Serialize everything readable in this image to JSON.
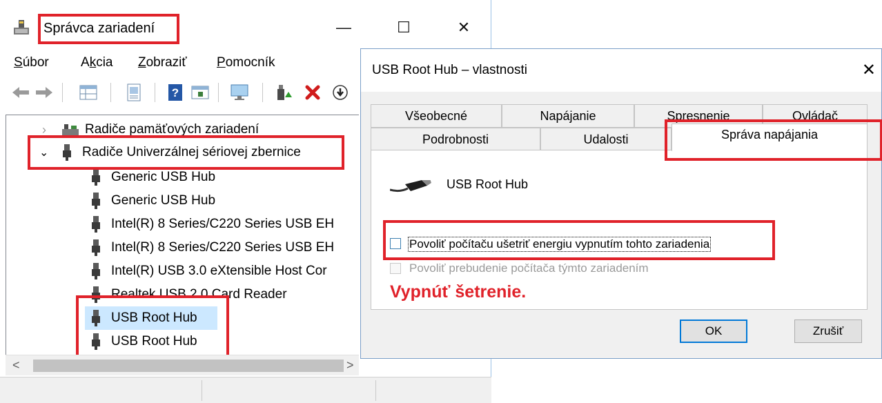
{
  "device_manager": {
    "title": "Správca zariadení",
    "controls": {
      "minimize": "—",
      "maximize": "☐",
      "close": "✕"
    },
    "menu": [
      {
        "pre": "",
        "u": "S",
        "post": "úbor"
      },
      {
        "pre": "A",
        "u": "k",
        "post": "cia"
      },
      {
        "pre": "",
        "u": "Z",
        "post": "obraziť"
      },
      {
        "pre": "",
        "u": "P",
        "post": "omocník"
      }
    ],
    "toolbar_icons": [
      "back-arrow-icon",
      "forward-arrow-icon",
      "properties-grid-icon",
      "document-icon",
      "help-icon",
      "view-icon",
      "monitor-icon",
      "enable-device-icon",
      "uninstall-x-icon",
      "update-driver-icon"
    ],
    "tree": {
      "category_memory": "Radiče pamäťových zariadení",
      "category_usb": "Radiče Univerzálnej sériovej zbernice",
      "devices": [
        "Generic USB Hub",
        "Generic USB Hub",
        "Intel(R) 8 Series/C220 Series USB EH",
        "Intel(R) 8 Series/C220 Series USB EH",
        "Intel(R) USB 3.0 eXtensible Host Cor",
        "Realtek USB 2.0 Card Reader",
        "USB Root Hub",
        "USB Root Hub"
      ]
    },
    "scroll": {
      "left": "<",
      "right": ">"
    }
  },
  "properties": {
    "title": "USB Root Hub – vlastnosti",
    "close": "✕",
    "tabs_row1": [
      "Všeobecné",
      "Napájanie",
      "Spresnenie",
      "Ovládač"
    ],
    "tabs_row2": [
      "Podrobnosti",
      "Udalosti",
      "Správa napájania"
    ],
    "device_name": "USB Root Hub",
    "option_save_power": "Povoliť počítaču ušetriť energiu vypnutím tohto zariadenia",
    "option_wake": "Povoliť prebudenie počítača týmto zariadením",
    "annotation": "Vypnúť šetrenie.",
    "ok": "OK",
    "cancel": "Zrušiť"
  },
  "colors": {
    "highlight_red": "#e0222a",
    "selection": "#cce8ff",
    "accent": "#0078d7"
  }
}
